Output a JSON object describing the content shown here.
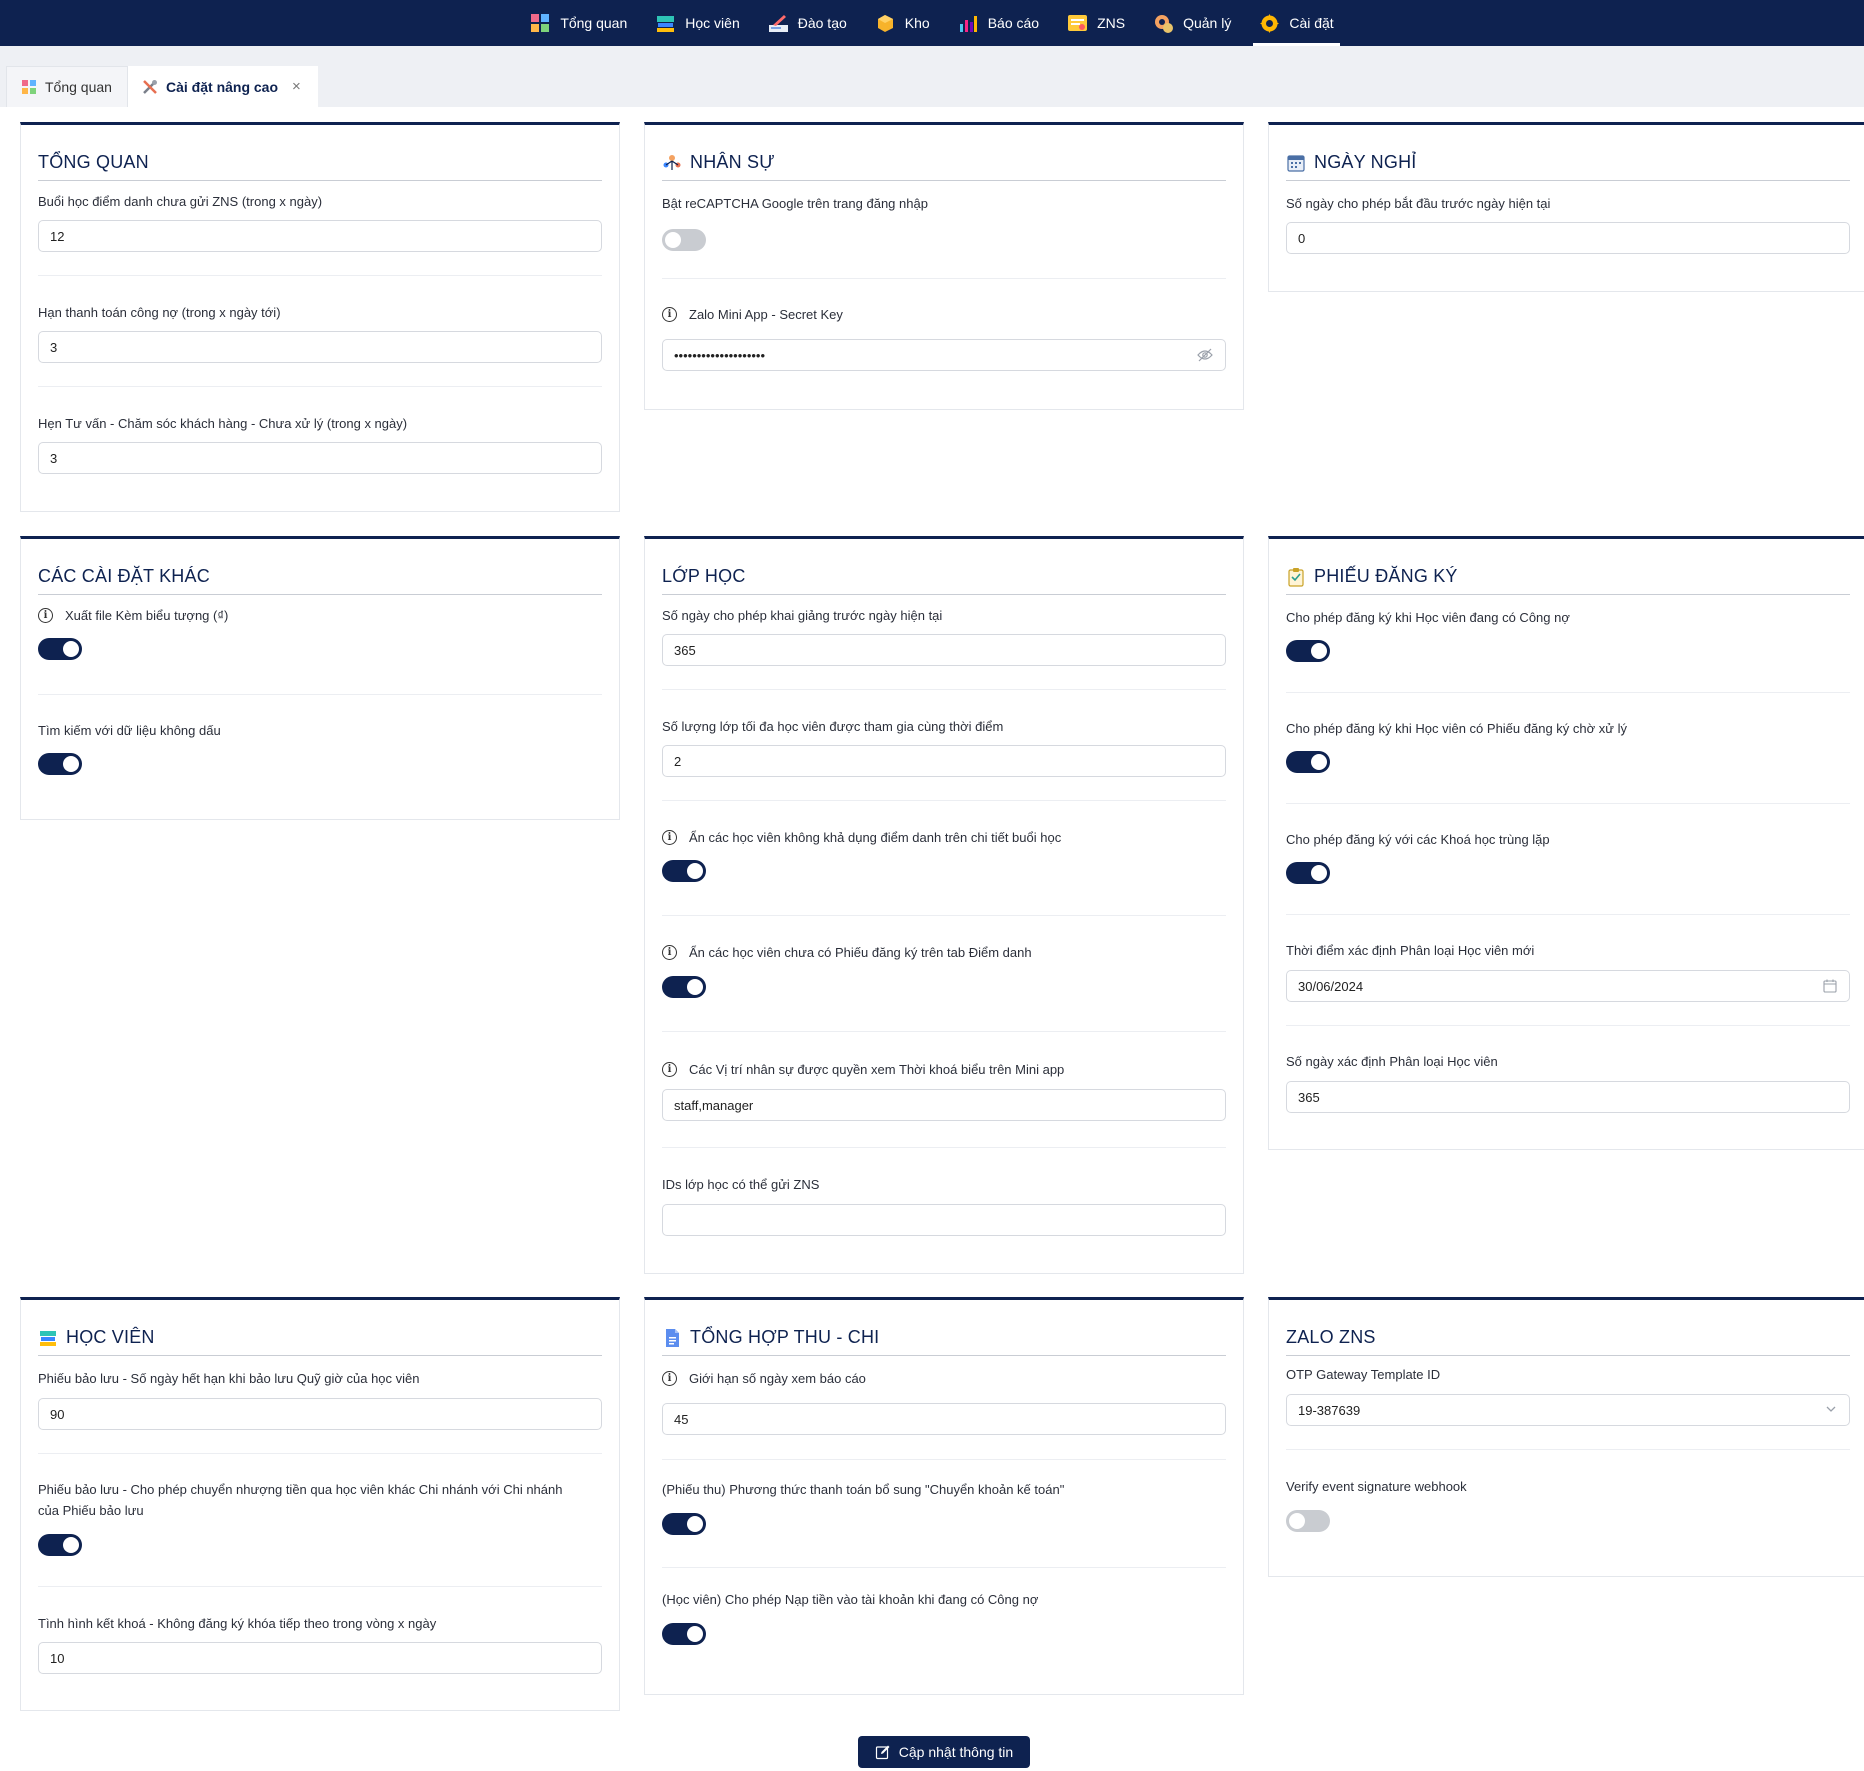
{
  "nav": {
    "items": [
      {
        "label": "Tổng quan",
        "icon": "dashboard-icon"
      },
      {
        "label": "Học viên",
        "icon": "student-icon"
      },
      {
        "label": "Đào tạo",
        "icon": "training-icon"
      },
      {
        "label": "Kho",
        "icon": "warehouse-icon"
      },
      {
        "label": "Báo cáo",
        "icon": "report-icon"
      },
      {
        "label": "ZNS",
        "icon": "zns-icon"
      },
      {
        "label": "Quản lý",
        "icon": "manage-icon"
      },
      {
        "label": "Cài đặt",
        "icon": "settings-icon"
      }
    ],
    "active": "Cài đặt"
  },
  "tabs": {
    "overview": "Tổng quan",
    "advanced": "Cài đặt nâng cao",
    "close": "×"
  },
  "cards": {
    "tong_quan": {
      "title": "TỔNG QUAN",
      "f1_label": "Buổi học điểm danh chưa gửi ZNS (trong x ngày)",
      "f1_value": "12",
      "f2_label": "Hạn thanh toán công nợ (trong x ngày tới)",
      "f2_value": "3",
      "f3_label": "Hẹn Tư vấn - Chăm sóc khách hàng - Chưa xử lý (trong x ngày)",
      "f3_value": "3"
    },
    "nhan_su": {
      "title": "NHÂN SỰ",
      "f1_label": "Bật reCAPTCHA Google trên trang đăng nhập",
      "f1_on": false,
      "f2_label": "Zalo Mini App - Secret Key",
      "f2_value": "••••••••••••••••••••"
    },
    "ngay_nghi": {
      "title": "NGÀY NGHỈ",
      "f1_label": "Số ngày cho phép bắt đầu trước ngày hiện tại",
      "f1_value": "0"
    },
    "cac_cai_dat_khac": {
      "title": "CÁC CÀI ĐẶT KHÁC",
      "f1_label": "Xuất file Kèm biểu tượng (₫)",
      "f1_on": true,
      "f2_label": "Tìm kiếm với dữ liệu không dấu",
      "f2_on": true
    },
    "lop_hoc": {
      "title": "LỚP HỌC",
      "f1_label": "Số ngày cho phép khai giảng trước ngày hiện tại",
      "f1_value": "365",
      "f2_label": "Số lượng lớp tối đa học viên được tham gia cùng thời điểm",
      "f2_value": "2",
      "f3_label": "Ẩn các học viên không khả dụng điểm danh trên chi tiết buổi học",
      "f3_on": true,
      "f4_label": "Ẩn các học viên chưa có Phiếu đăng ký trên tab Điểm danh",
      "f4_on": true,
      "f5_label": "Các Vị trí nhân sự được quyền xem Thời khoá biểu trên Mini app",
      "f5_value": "staff,manager",
      "f6_label": "IDs lớp học có thể gửi ZNS",
      "f6_value": ""
    },
    "phieu_dang_ky": {
      "title": "PHIẾU ĐĂNG KÝ",
      "f1_label": "Cho phép đăng ký khi Học viên đang có Công nợ",
      "f1_on": true,
      "f2_label": "Cho phép đăng ký khi Học viên có Phiếu đăng ký chờ xử lý",
      "f2_on": true,
      "f3_label": "Cho phép đăng ký với các Khoá học trùng lặp",
      "f3_on": true,
      "f4_label": "Thời điểm xác định Phân loại Học viên mới",
      "f4_value": "30/06/2024",
      "f5_label": "Số ngày xác định Phân loại Học viên",
      "f5_value": "365"
    },
    "hoc_vien": {
      "title": "HỌC VIÊN",
      "f1_label": "Phiếu bảo lưu - Số ngày hết hạn khi bảo lưu Quỹ giờ của học viên",
      "f1_value": "90",
      "f2_label": "Phiếu bảo lưu - Cho phép chuyển nhượng tiền qua học viên khác Chi nhánh với Chi nhánh của Phiếu bảo lưu",
      "f2_on": true,
      "f3_label": "Tình hình kết khoá - Không đăng ký khóa tiếp theo trong vòng x ngày",
      "f3_value": "10"
    },
    "thu_chi": {
      "title": "TỔNG HỢP THU - CHI",
      "f1_label": "Giới hạn số ngày xem báo cáo",
      "f1_value": "45",
      "f2_label": "(Phiếu thu) Phương thức thanh toán bổ sung \"Chuyển khoản kế toán\"",
      "f2_on": true,
      "f3_label": "(Học viên) Cho phép Nạp tiền vào tài khoản khi đang có Công nợ",
      "f3_on": true
    },
    "zalo_zns": {
      "title": "ZALO ZNS",
      "f1_label": "OTP Gateway Template ID",
      "f1_value": "19-387639",
      "f2_label": "Verify event signature webhook",
      "f2_on": false
    }
  },
  "submit_label": "Cập nhật thông tin",
  "colors": {
    "primary": "#0e2250",
    "toggle_off": "#c9ccd1",
    "background": "#eef0f4"
  }
}
